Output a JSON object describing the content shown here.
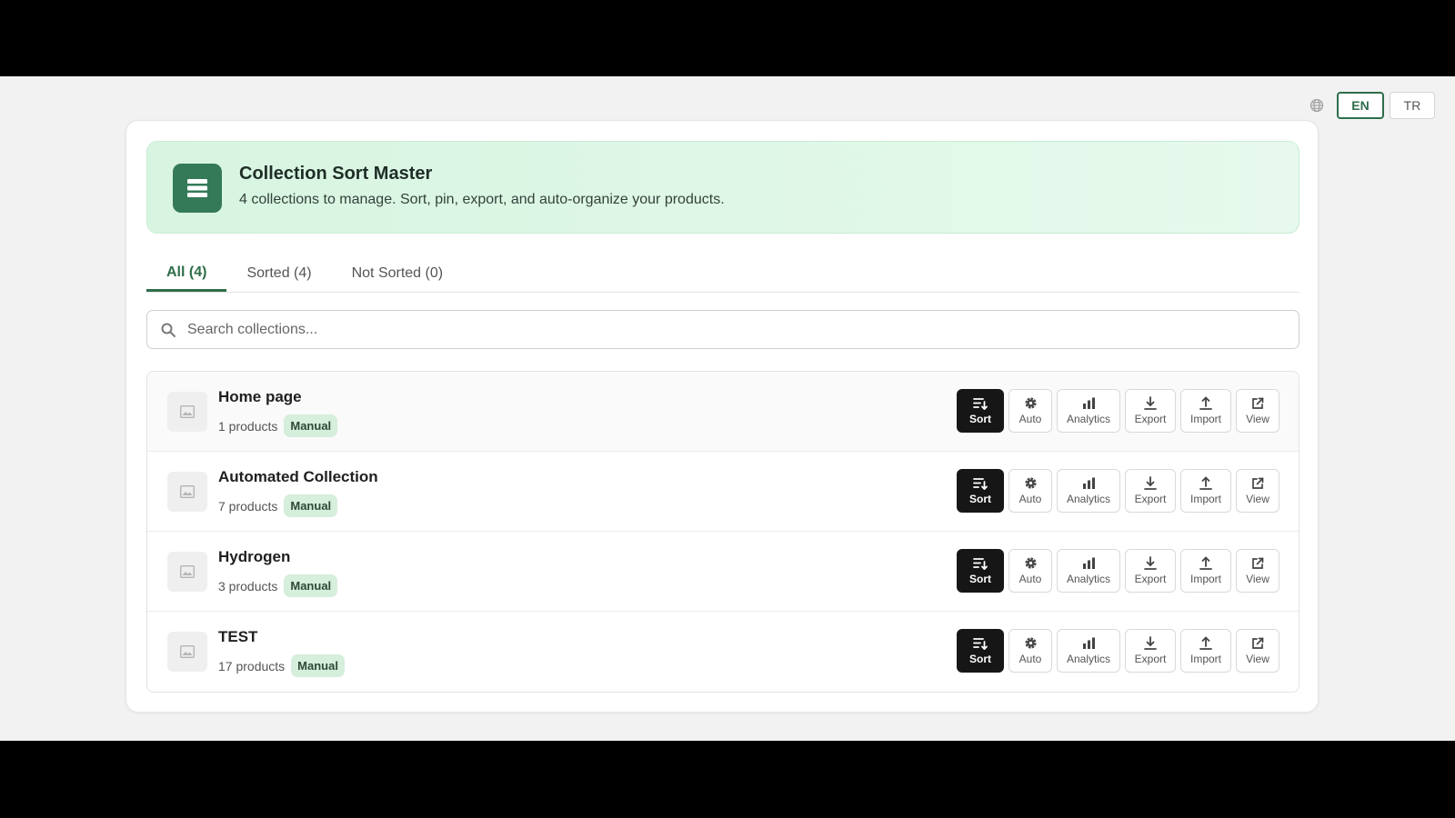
{
  "language": {
    "options": [
      {
        "label": "EN",
        "active": true
      },
      {
        "label": "TR",
        "active": false
      }
    ]
  },
  "header": {
    "title": "Collection Sort Master",
    "subtitle": "4 collections to manage. Sort, pin, export, and auto-organize your products."
  },
  "tabs": [
    {
      "label": "All (4)",
      "active": true
    },
    {
      "label": "Sorted (4)",
      "active": false
    },
    {
      "label": "Not Sorted (0)",
      "active": false
    }
  ],
  "search": {
    "placeholder": "Search collections..."
  },
  "actions": {
    "sort": "Sort",
    "auto": "Auto",
    "analytics": "Analytics",
    "export": "Export",
    "import": "Import",
    "view": "View"
  },
  "collections": [
    {
      "title": "Home page",
      "count": "1 products",
      "badge": "Manual"
    },
    {
      "title": "Automated Collection",
      "count": "7 products",
      "badge": "Manual"
    },
    {
      "title": "Hydrogen",
      "count": "3 products",
      "badge": "Manual"
    },
    {
      "title": "TEST",
      "count": "17 products",
      "badge": "Manual"
    }
  ],
  "colors": {
    "brand": "#347a58",
    "accent": "#2f6e4a",
    "hero_bg": "#dcf6e4",
    "badge_bg": "#d6eedc",
    "sort_button": "#161616"
  }
}
